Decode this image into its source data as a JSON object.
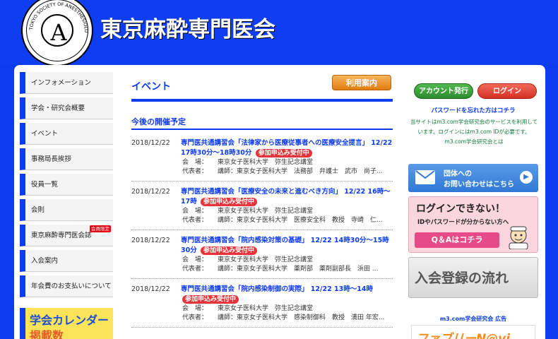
{
  "header": {
    "site_title": "東京麻酔専門医会",
    "logo_text": "TOKYO SOCIETY OF ANESTHESIOLOGISTS"
  },
  "sidebar": {
    "items": [
      {
        "label": "インフォメーション"
      },
      {
        "label": "学会・研究会概要"
      },
      {
        "label": "イベント"
      },
      {
        "label": "事務局長挨拶"
      },
      {
        "label": "役員一覧"
      },
      {
        "label": "会則"
      },
      {
        "label": "東京麻酔専門医会誌",
        "badge": "会員限定"
      },
      {
        "label": "入会案内"
      },
      {
        "label": "年会費のお支払いについて"
      }
    ],
    "calendar_banner": {
      "line1": "学会カレンダー",
      "line2": "掲載数"
    }
  },
  "main": {
    "page_title": "イベント",
    "guide_button": "利用案内",
    "section_title": "今後の開催予定",
    "events": [
      {
        "date": "2018/12/22",
        "title": "専門医共通講習会「法律家から医療従事者への医療安全提言」 12/22 17時30分～18時30分",
        "status": "参加申込み受付中",
        "venue_label": "会　場：",
        "venue": "東京女子医科大学　弥生記念講堂",
        "rep_label": "代表者：",
        "rep": "講師：東京女子医科大学　法務部　弁護士　武市　尚子..."
      },
      {
        "date": "2018/12/22",
        "title": "専門医共通講習会「医療安全の未来と進むべき方向」 12/22 16時～17時",
        "status": "参加申込み受付中",
        "venue_label": "会　場：",
        "venue": "東京女子医科大学　弥生記念講堂",
        "rep_label": "代表者：",
        "rep": "講師：東京女子医科大学　医療安全科　教授　寺崎　仁..."
      },
      {
        "date": "2018/12/22",
        "title": "専門医共通講習会「院内感染対策の基礎」 12/22 14時30分～15時30分",
        "status": "参加申込み受付中",
        "venue_label": "会　場：",
        "venue": "東京女子医科大学　弥生記念講堂",
        "rep_label": "代表者：",
        "rep": "講師：東京女子医科大学　薬剤部　薬剤副部長　浜田 ..."
      },
      {
        "date": "2018/12/22",
        "title": "専門医共通講習会「院内感染制御の実際」 12/22 13時～14時",
        "status": "参加申込み受付中",
        "venue_label": "会　場：",
        "venue": "東京女子医科大学　弥生記念講堂",
        "rep_label": "代表者：",
        "rep": "講師：東京女子医科大学　感染制御科　教授　満田 年宏..."
      }
    ]
  },
  "right": {
    "account_button": "アカウント発行",
    "login_button": "ログイン",
    "forgot_link": "パスワードを忘れた方はコチラ",
    "m3_note": "当サイトはm3.com学会研究会のサービスを利用しています。ログインにはm3.com IDが必要です。 m3.com学会研究会とは",
    "contact_banner": {
      "line1": "団体への",
      "line2": "お問い合わせはこちら"
    },
    "trouble_banner": {
      "heading": "ログインできない！",
      "sub": "IDやパスワードが分からない方へ",
      "qa": "Q＆Aはコチラ"
    },
    "join_banner": "入会登録の流れ",
    "ad_label": "m3.com学会研究会 広告",
    "ad_banner": "ファブリーN@vi"
  },
  "colors": {
    "brand_blue": "#0d3cf0",
    "status_red": "#e6343a",
    "guide_orange": "#e07d10"
  }
}
